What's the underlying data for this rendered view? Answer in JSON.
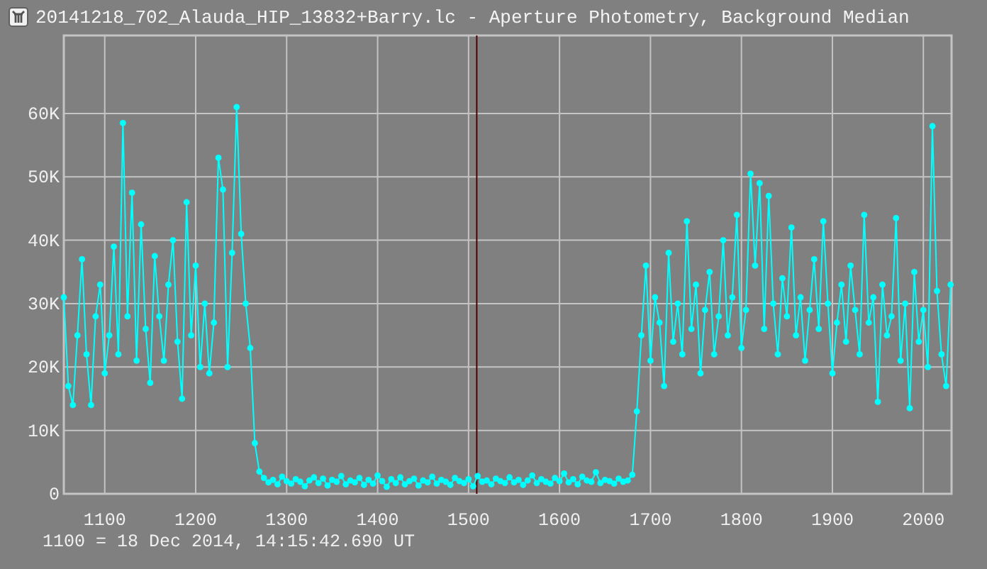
{
  "window": {
    "title": "20141218_702_Alauda_HIP_13832+Barry.lc - Aperture Photometry, Background Median"
  },
  "chart": {
    "chart_data": {
      "type": "line",
      "xlim": [
        1055,
        2031
      ],
      "ylim": [
        0,
        72300
      ],
      "xticks": [
        1100,
        1200,
        1300,
        1400,
        1500,
        1600,
        1700,
        1800,
        1900,
        2000
      ],
      "yticks": [
        {
          "value": 0,
          "label": "0"
        },
        {
          "value": 10000,
          "label": "10K"
        },
        {
          "value": 20000,
          "label": "20K"
        },
        {
          "value": 30000,
          "label": "30K"
        },
        {
          "value": 40000,
          "label": "40K"
        },
        {
          "value": 50000,
          "label": "50K"
        },
        {
          "value": 60000,
          "label": "60K"
        }
      ],
      "grid": true,
      "ref_lines": [
        {
          "axis": "x",
          "value": 1509
        }
      ],
      "x": [
        1055,
        1060,
        1065,
        1070,
        1075,
        1080,
        1085,
        1090,
        1095,
        1100,
        1105,
        1110,
        1115,
        1120,
        1125,
        1130,
        1135,
        1140,
        1145,
        1150,
        1155,
        1160,
        1165,
        1170,
        1175,
        1180,
        1185,
        1190,
        1195,
        1200,
        1205,
        1210,
        1215,
        1220,
        1225,
        1230,
        1235,
        1240,
        1245,
        1250,
        1255,
        1260,
        1265,
        1270,
        1275,
        1280,
        1285,
        1290,
        1295,
        1300,
        1305,
        1310,
        1315,
        1320,
        1325,
        1330,
        1335,
        1340,
        1345,
        1350,
        1355,
        1360,
        1365,
        1370,
        1375,
        1380,
        1385,
        1390,
        1395,
        1400,
        1405,
        1410,
        1415,
        1420,
        1425,
        1430,
        1435,
        1440,
        1445,
        1450,
        1455,
        1460,
        1465,
        1470,
        1475,
        1480,
        1485,
        1490,
        1495,
        1500,
        1505,
        1510,
        1515,
        1520,
        1525,
        1530,
        1535,
        1540,
        1545,
        1550,
        1555,
        1560,
        1565,
        1570,
        1575,
        1580,
        1585,
        1590,
        1595,
        1600,
        1605,
        1610,
        1615,
        1620,
        1625,
        1630,
        1635,
        1640,
        1645,
        1650,
        1655,
        1660,
        1665,
        1670,
        1675,
        1680,
        1685,
        1690,
        1695,
        1700,
        1705,
        1710,
        1715,
        1720,
        1725,
        1730,
        1735,
        1740,
        1745,
        1750,
        1755,
        1760,
        1765,
        1770,
        1775,
        1780,
        1785,
        1790,
        1795,
        1800,
        1805,
        1810,
        1815,
        1820,
        1825,
        1830,
        1835,
        1840,
        1845,
        1850,
        1855,
        1860,
        1865,
        1870,
        1875,
        1880,
        1885,
        1890,
        1895,
        1900,
        1905,
        1910,
        1915,
        1920,
        1925,
        1930,
        1935,
        1940,
        1945,
        1950,
        1955,
        1960,
        1965,
        1970,
        1975,
        1980,
        1985,
        1990,
        1995,
        2000,
        2005,
        2010,
        2015,
        2020,
        2025,
        2030
      ],
      "series": [
        {
          "color": "#00ffff",
          "marker": "circle",
          "values": [
            31000,
            17000,
            14000,
            25000,
            37000,
            22000,
            14000,
            28000,
            33000,
            19000,
            25000,
            39000,
            22000,
            58500,
            28000,
            47500,
            21000,
            42500,
            26000,
            17500,
            37500,
            28000,
            21000,
            33000,
            40000,
            24000,
            15000,
            46000,
            25000,
            36000,
            20000,
            30000,
            19000,
            27000,
            53000,
            48000,
            20000,
            38000,
            61000,
            41000,
            30000,
            23000,
            8000,
            3500,
            2500,
            1800,
            2200,
            1500,
            2700,
            2000,
            1600,
            2300,
            1900,
            1200,
            2100,
            2600,
            1700,
            2400,
            1300,
            2200,
            1900,
            2800,
            1500,
            2100,
            1800,
            2500,
            1400,
            2200,
            1600,
            2900,
            2000,
            1100,
            2300,
            1700,
            2600,
            1500,
            2000,
            2400,
            1300,
            2100,
            1800,
            2700,
            1600,
            2200,
            1900,
            1400,
            2500,
            2000,
            1700,
            2300,
            1200,
            2800,
            1900,
            2100,
            1500,
            2400,
            2000,
            1700,
            2600,
            1800,
            2200,
            1400,
            2100,
            2900,
            1700,
            2300,
            1900,
            1600,
            2500,
            2000,
            3200,
            1800,
            2300,
            1500,
            2700,
            2100,
            1900,
            3400,
            1700,
            2200,
            2000,
            1600,
            2400,
            1900,
            2100,
            3000,
            13000,
            25000,
            36000,
            21000,
            31000,
            27000,
            17000,
            38000,
            24000,
            30000,
            22000,
            43000,
            26000,
            33000,
            19000,
            29000,
            35000,
            22000,
            28000,
            40000,
            25000,
            31000,
            44000,
            23000,
            29000,
            50500,
            36000,
            49000,
            26000,
            47000,
            30000,
            22000,
            34000,
            28000,
            42000,
            25000,
            31000,
            21000,
            29000,
            37000,
            26000,
            43000,
            30000,
            19000,
            27000,
            33000,
            24000,
            36000,
            29000,
            22000,
            44000,
            27000,
            31000,
            14500,
            33000,
            25000,
            28000,
            43500,
            21000,
            30000,
            13500,
            35000,
            24000,
            29000,
            20000,
            58000,
            32000,
            22000,
            17000,
            33000
          ]
        }
      ]
    }
  },
  "footer": "1100 = 18 Dec 2014, 14:15:42.690 UT"
}
